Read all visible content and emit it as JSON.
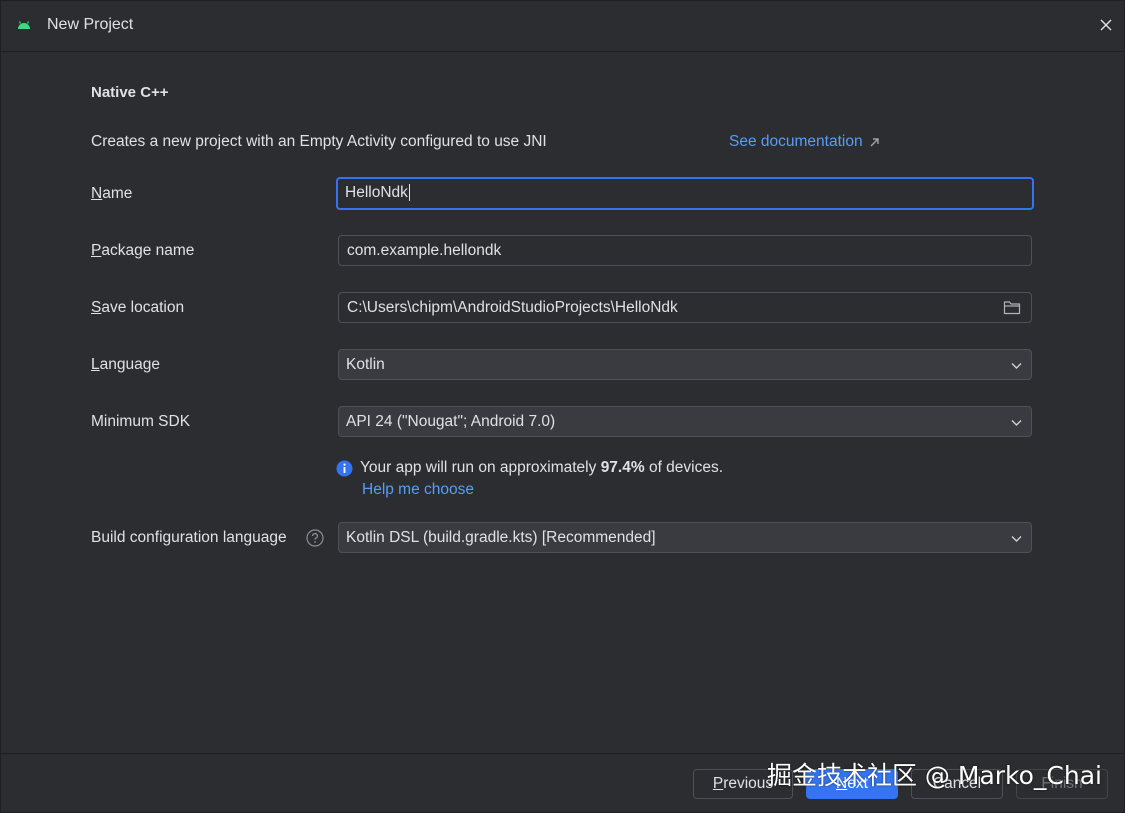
{
  "window": {
    "title": "New Project"
  },
  "template": {
    "title": "Native C++",
    "description": "Creates a new project with an Empty Activity configured to use JNI",
    "doc_link": "See documentation"
  },
  "form": {
    "name": {
      "label_mn": "N",
      "label_rest": "ame",
      "value": "HelloNdk"
    },
    "package": {
      "label_mn": "P",
      "label_rest": "ackage name",
      "value": "com.example.hellondk"
    },
    "save_location": {
      "label_mn": "S",
      "label_rest": "ave location",
      "value": "C:\\Users\\chipm\\AndroidStudioProjects\\HelloNdk"
    },
    "language": {
      "label_mn": "L",
      "label_rest": "anguage",
      "value": "Kotlin"
    },
    "min_sdk": {
      "label": "Minimum SDK",
      "value": "API 24 (\"Nougat\"; Android 7.0)"
    },
    "sdk_info": {
      "prefix": "Your app will run on approximately ",
      "percent": "97.4%",
      "suffix": " of devices.",
      "help_link": "Help me choose"
    },
    "build_config": {
      "label": "Build configuration language",
      "value": "Kotlin DSL (build.gradle.kts) [Recommended]"
    }
  },
  "footer": {
    "previous_mn": "P",
    "previous_rest": "revious",
    "next_mn": "N",
    "next_rest": "ext",
    "cancel": "Cancel",
    "finish": "Finish"
  },
  "watermark": "掘金技术社区 @ Marko_Chai",
  "colors": {
    "background": "#2b2d30",
    "accent": "#3574f0",
    "link": "#589df6",
    "android_green": "#3ddc84"
  },
  "icons": [
    "android-icon",
    "close-icon",
    "external-link-icon",
    "folder-icon",
    "chevron-down-icon",
    "info-icon",
    "help-icon"
  ]
}
